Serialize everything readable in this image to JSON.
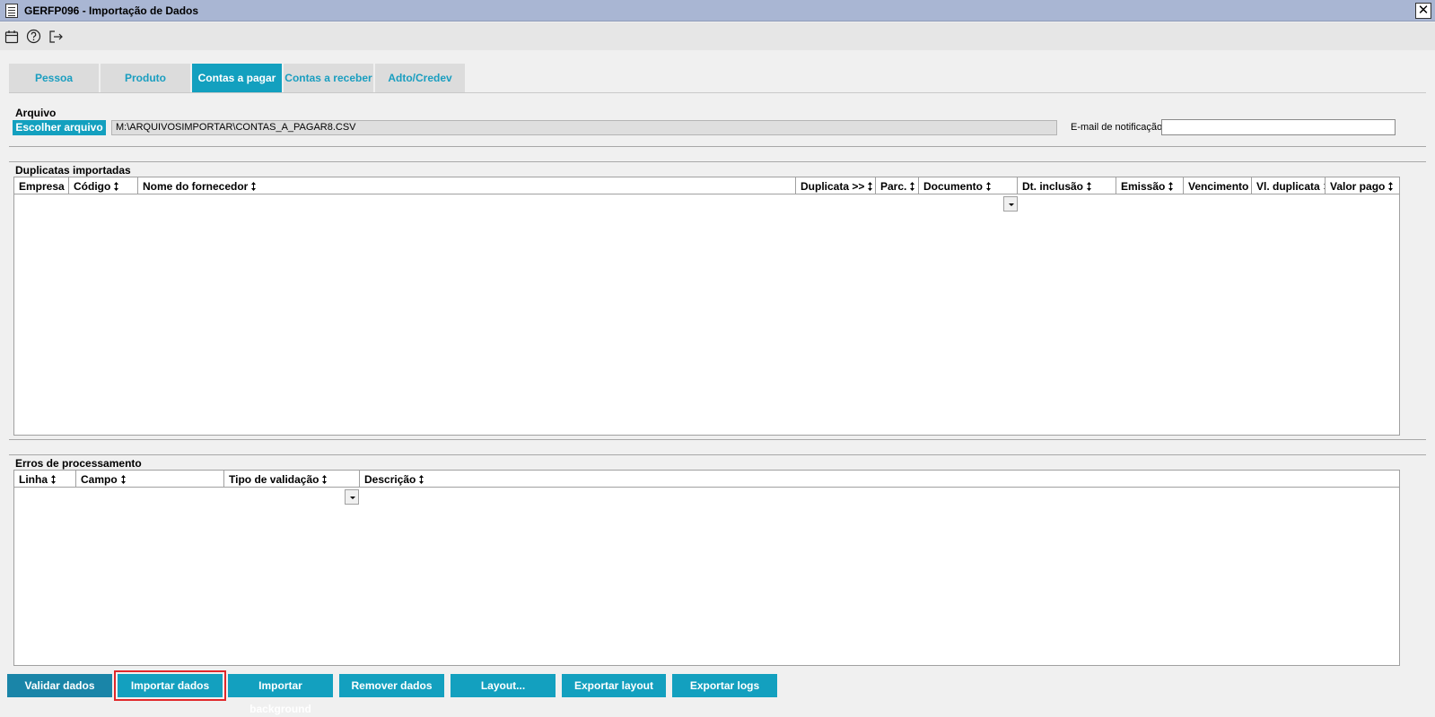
{
  "window": {
    "title": "GERFP096 - Importação de Dados",
    "close_label": "✕"
  },
  "toolbar": {
    "icons": [
      "calendar-icon",
      "help-icon",
      "exit-icon"
    ]
  },
  "tabs": [
    {
      "label": "Pessoa",
      "active": false
    },
    {
      "label": "Produto",
      "active": false
    },
    {
      "label": "Contas a pagar",
      "active": true
    },
    {
      "label": "Contas a receber",
      "active": false
    },
    {
      "label": "Adto/Credev",
      "active": false
    }
  ],
  "arquivo": {
    "section_title": "Arquivo",
    "choose_button": "Escolher arquivo",
    "file_path": "M:\\ARQUIVOSIMPORTAR\\CONTAS_A_PAGAR8.CSV",
    "email_label": "E-mail de notificação",
    "email_value": ""
  },
  "duplicatas": {
    "section_title": "Duplicatas importadas",
    "columns": [
      "Empresa",
      "Código",
      "Nome do fornecedor",
      "Duplicata >>",
      "Parc.",
      "Documento",
      "Dt. inclusão",
      "Emissão",
      "Vencimento",
      "Vl. duplicata",
      "Valor pago"
    ]
  },
  "erros": {
    "section_title": "Erros de processamento",
    "columns": [
      "Linha",
      "Campo",
      "Tipo de validação",
      "Descrição"
    ]
  },
  "actions": {
    "validar": "Validar dados",
    "importar": "Importar dados",
    "importar_bg": "Importar background",
    "remover": "Remover dados",
    "layout": "Layout...",
    "exportar_layout": "Exportar layout",
    "exportar_logs": "Exportar logs"
  },
  "colors": {
    "accent": "#13a0bf",
    "titlebar": "#a9b6d3",
    "highlight": "#e0282b"
  }
}
